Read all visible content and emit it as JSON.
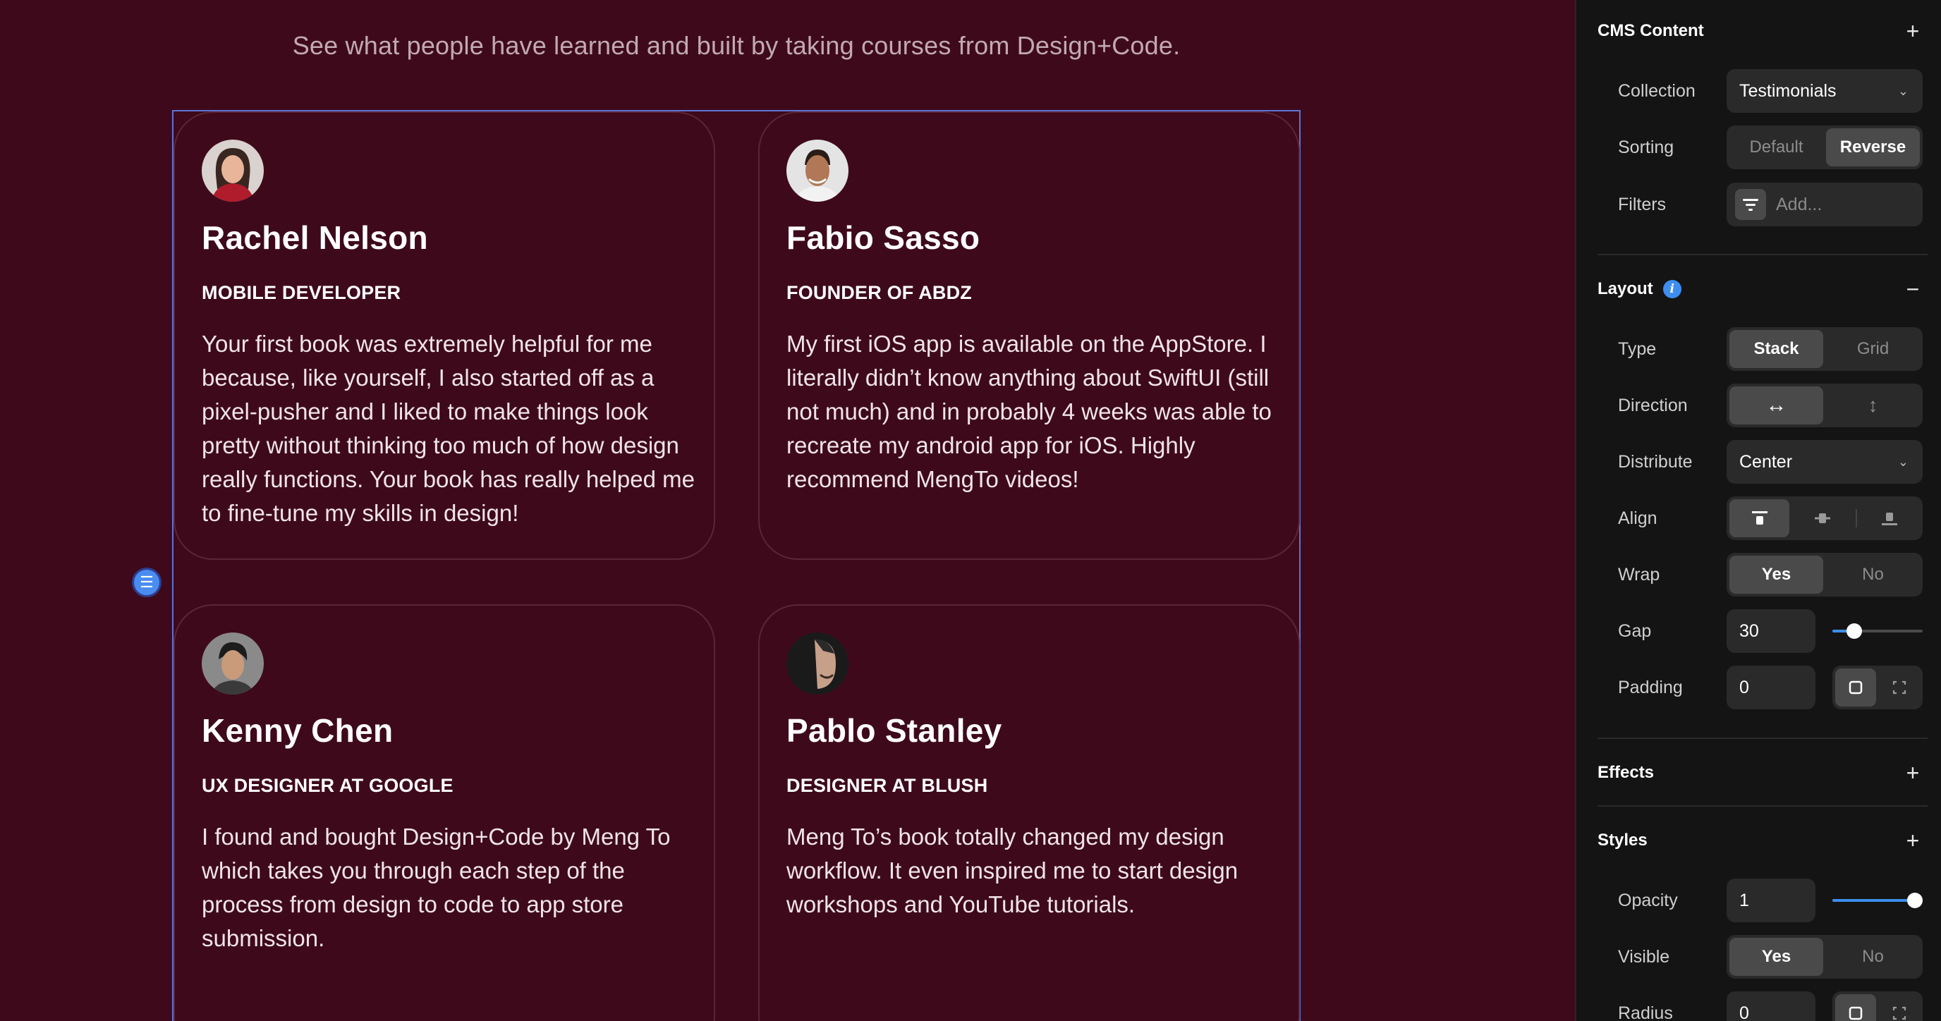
{
  "canvas": {
    "subtitle": "See what people have learned and built by taking courses from Design+Code.",
    "testimonials": [
      {
        "name": "Rachel Nelson",
        "role": "MOBILE DEVELOPER",
        "text": "Your first book was extremely helpful for me because, like yourself, I also started off as a pixel-pusher and I liked to make things look pretty without thinking too much of how design really functions. Your book has really helped me to fine-tune my skills in design!"
      },
      {
        "name": "Fabio Sasso",
        "role": "FOUNDER OF ABDZ",
        "text": "My first iOS app is available on the AppStore. I literally didn’t know anything about SwiftUI (still not much) and in probably 4 weeks was able to recreate my android app for iOS. Highly recommend MengTo videos!"
      },
      {
        "name": "Kenny Chen",
        "role": "UX DESIGNER AT GOOGLE",
        "text": "I found and bought Design+Code by Meng To which takes you through each step of the process from design to code to app store submission."
      },
      {
        "name": "Pablo Stanley",
        "role": "DESIGNER AT BLUSH",
        "text": "Meng To’s book totally changed my design workflow. It even inspired me to start design workshops and YouTube tutorials."
      }
    ]
  },
  "panel": {
    "cms": {
      "title": "CMS Content",
      "action_icon": "plus-icon",
      "collection_label": "Collection",
      "collection_value": "Testimonials",
      "sorting_label": "Sorting",
      "sorting_options": [
        "Default",
        "Reverse"
      ],
      "sorting_selected": "Reverse",
      "filters_label": "Filters",
      "filters_placeholder": "Add..."
    },
    "layout": {
      "title": "Layout",
      "action_icon": "minus-icon",
      "type_label": "Type",
      "type_options": [
        "Stack",
        "Grid"
      ],
      "type_selected": "Stack",
      "direction_label": "Direction",
      "direction_options": [
        "horizontal-arrows-icon",
        "vertical-arrows-icon"
      ],
      "direction_selected": "horizontal",
      "distribute_label": "Distribute",
      "distribute_value": "Center",
      "align_label": "Align",
      "align_options": [
        "align-top-icon",
        "align-center-icon",
        "align-bottom-icon"
      ],
      "align_selected": "top",
      "wrap_label": "Wrap",
      "wrap_options": [
        "Yes",
        "No"
      ],
      "wrap_selected": "Yes",
      "gap_label": "Gap",
      "gap_value": "30",
      "gap_slider_fraction": 0.19,
      "padding_label": "Padding",
      "padding_value": "0",
      "padding_modes": [
        "uniform-padding-icon",
        "individual-padding-icon"
      ]
    },
    "effects": {
      "title": "Effects",
      "action_icon": "plus-icon"
    },
    "styles": {
      "title": "Styles",
      "action_icon": "plus-icon",
      "opacity_label": "Opacity",
      "opacity_value": "1",
      "opacity_slider_fraction": 1.0,
      "visible_label": "Visible",
      "visible_options": [
        "Yes",
        "No"
      ],
      "visible_selected": "Yes",
      "radius_label": "Radius",
      "radius_value": "0"
    }
  },
  "colors": {
    "canvas_bg": "#3e0a1b",
    "panel_bg": "#141414",
    "accent": "#3d8ef0",
    "selection": "#5b74d8"
  }
}
